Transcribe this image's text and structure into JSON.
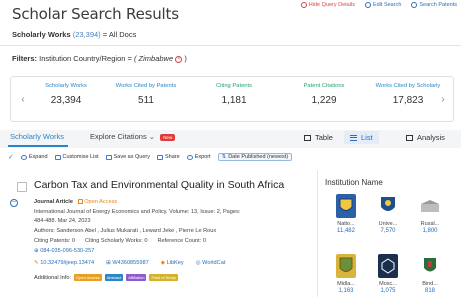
{
  "header": {
    "title": "Scholar Search Results",
    "actions": [
      {
        "label": "Hide Query Details",
        "icon": "eye-off-icon",
        "color": "#d64545"
      },
      {
        "label": "Edit Search",
        "icon": "search-icon",
        "color": "#2a6ebb"
      },
      {
        "label": "Search Patents",
        "icon": "search-icon",
        "color": "#2a6ebb"
      }
    ]
  },
  "scope": {
    "label": "Scholarly Works",
    "count": "(23,394)",
    "rest": "= All Docs"
  },
  "filters": {
    "label": "Filters:",
    "field": "Institution Country/Region =",
    "value": "( Zimbabwe",
    "close": ")"
  },
  "stats": [
    {
      "label": "Scholarly Works",
      "value": "23,394",
      "color": "#2a86c8"
    },
    {
      "label": "Works Cited by Patents",
      "value": "511",
      "color": "#2a86c8"
    },
    {
      "label": "Citing Patents",
      "value": "1,181",
      "color": "#27a36b"
    },
    {
      "label": "Patent Citations",
      "value": "1,229",
      "color": "#27a36b"
    },
    {
      "label": "Works Cited by Scholarly",
      "value": "17,823",
      "color": "#2a86c8"
    }
  ],
  "tabs": {
    "scholarly": "Scholarly Works",
    "explore": "Explore Citations",
    "new_badge": "New",
    "table": "Table",
    "list": "List",
    "analysis": "Analysis"
  },
  "toolbar": {
    "expand": "Expand",
    "customise": "Customise List",
    "save": "Save as Query",
    "share": "Share",
    "export": "Export",
    "sort": "Date Published (newest)"
  },
  "result": {
    "title": "Carbon Tax and Environmental Quality in South Africa",
    "type": "Journal Article",
    "access": "Open Access",
    "journal_line": "International Journal of Energy Economics and Policy, Volume: 13, Issue: 2, Pages:",
    "pages_date": "484-488. Mar 24, 2023",
    "authors": "Authors: Sanderson Abel , Julius Mukarati , Leward Jeke , Pierre Le Roux",
    "citing_patents": "Citing Patents: 0",
    "citing_scholarly": "Citing Scholarly Works: 0",
    "reference_count": "Reference Count: 0",
    "orcid": "084-035-096-530-257",
    "doi": "10.32479/ijeep.13474",
    "pmid": "W4360855987",
    "libkey": "LibKey",
    "worldcat": "WorldCat",
    "additional_info": "Additional Info:",
    "tags": [
      {
        "label": "Open Access",
        "color": "#e8a020"
      },
      {
        "label": "Abstract",
        "color": "#2a86c8"
      },
      {
        "label": "Affiliation",
        "color": "#8e5bd0"
      },
      {
        "label": "Field of Study",
        "color": "#d4b32a"
      }
    ]
  },
  "institutions": {
    "title": "Institution Name",
    "items": [
      {
        "name": "Natio...",
        "count": "11,482",
        "color": "#2b5fa8"
      },
      {
        "name": "Unive...",
        "count": "7,570",
        "color": "#1d4f8c"
      },
      {
        "name": "Rusal...",
        "count": "1,800",
        "color": "#c8c8c8"
      },
      {
        "name": "Midla...",
        "count": "1,163",
        "color": "#d8b43c"
      },
      {
        "name": "Mosc...",
        "count": "1,075",
        "color": "#1a2f4e"
      },
      {
        "name": "Bind...",
        "count": "818",
        "color": "#2d6b3a"
      }
    ]
  }
}
